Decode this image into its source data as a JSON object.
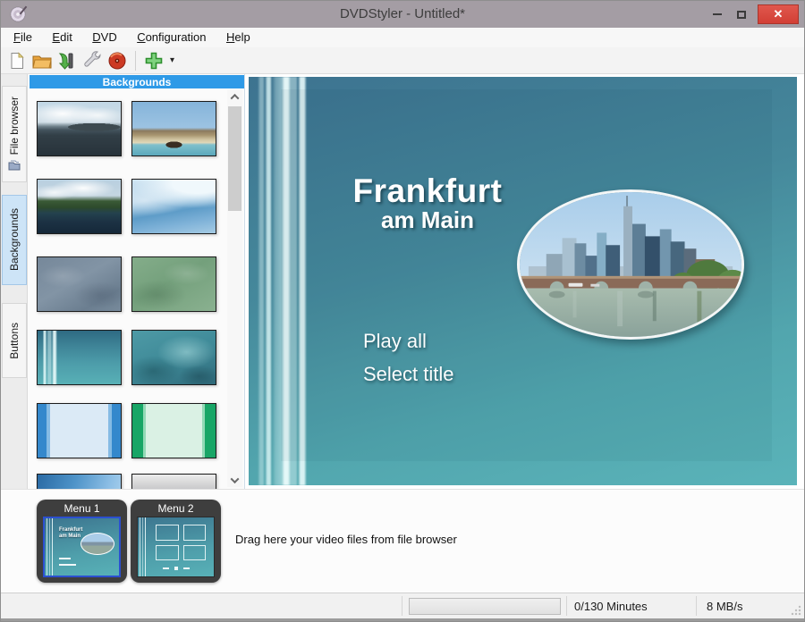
{
  "window": {
    "title": "DVDStyler - Untitled*",
    "app_icon": "dvd-disc-icon",
    "controls": {
      "minimize": "minimize-icon",
      "maximize": "maximize-icon",
      "close": "✕"
    }
  },
  "menubar": {
    "items": [
      {
        "label": "File"
      },
      {
        "label": "Edit"
      },
      {
        "label": "DVD"
      },
      {
        "label": "Configuration"
      },
      {
        "label": "Help"
      }
    ]
  },
  "toolbar": {
    "buttons": [
      {
        "name": "new-project",
        "icon": "new-document-icon"
      },
      {
        "name": "open-project",
        "icon": "open-folder-icon"
      },
      {
        "name": "save-project",
        "icon": "save-green-arrow-icon"
      },
      {
        "name": "settings",
        "icon": "wrench-icon"
      },
      {
        "name": "burn",
        "icon": "burn-disc-icon"
      },
      {
        "name": "add-file",
        "icon": "green-plus-icon",
        "has_dropdown": true
      }
    ],
    "caret": "▾"
  },
  "sidebar": {
    "tabs": [
      {
        "label": "File browser",
        "icon": "folder-icon",
        "active": false
      },
      {
        "label": "Backgrounds",
        "active": true
      },
      {
        "label": "Buttons",
        "active": false
      }
    ]
  },
  "backgrounds_panel": {
    "header": "Backgrounds",
    "thumbnails": [
      "sea-island-photo",
      "boat-on-beach-photo",
      "lake-shore-photo",
      "blue-waves-art",
      "blue-gray-clouds-art",
      "green-texture-art",
      "teal-stripes-art",
      "teal-water-art",
      "blue-frame-art",
      "green-frame-art",
      "blue-gradient-art",
      "gray-gradient-art"
    ]
  },
  "preview": {
    "menu_title_line1": "Frankfurt",
    "menu_title_line2": "am Main",
    "menu_buttons": [
      "Play all",
      "Select title"
    ],
    "image": "frankfurt-skyline-oval-photo",
    "background_colors": {
      "top": "#3d7390",
      "bottom": "#5ab3b9"
    }
  },
  "menus_strip": {
    "items": [
      {
        "label": "Menu 1",
        "selected": true
      },
      {
        "label": "Menu 2",
        "selected": false
      }
    ],
    "hint": "Drag here your video files from file browser"
  },
  "statusbar": {
    "progress_fraction": 0,
    "minutes": "0/130 Minutes",
    "speed": "8 MB/s"
  },
  "colors": {
    "titlebar": "#a49da4",
    "close_button": "#d9453c",
    "panel_header_blue": "#2e9ae7",
    "active_tab_blue": "#cde4f7"
  }
}
